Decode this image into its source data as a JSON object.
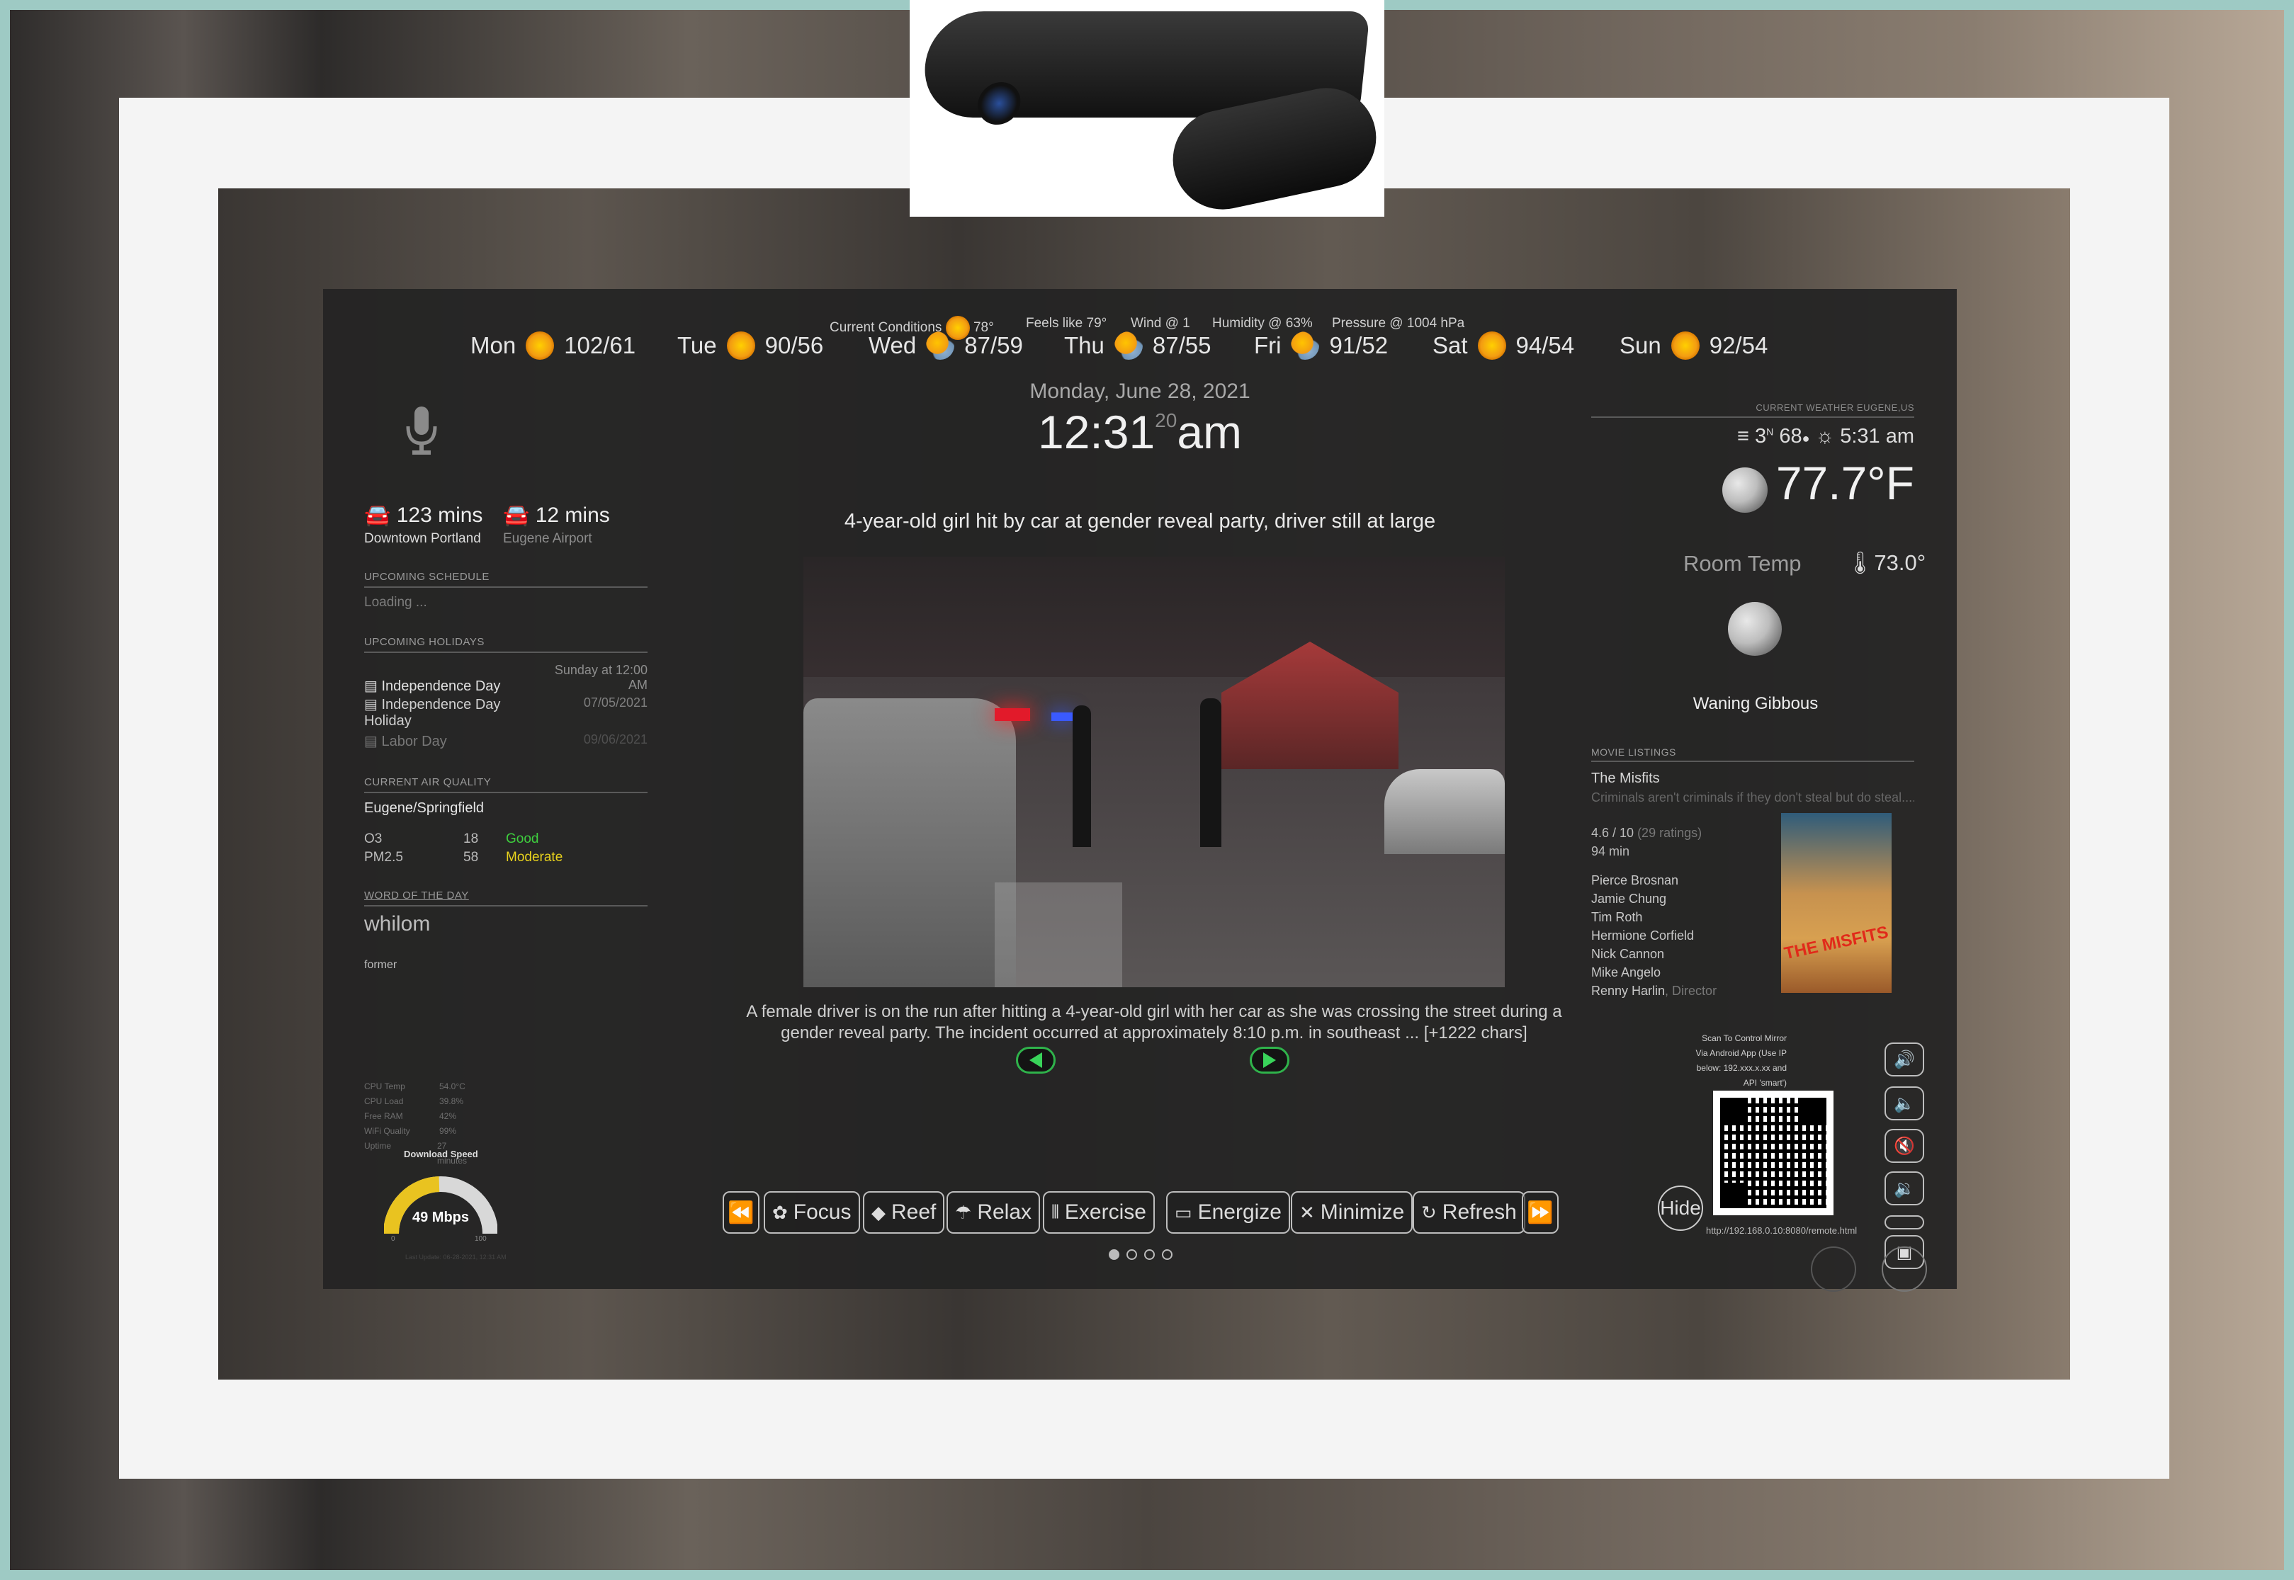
{
  "forecast": [
    {
      "day": "Mon",
      "temps": "102/61",
      "icon": "sun-icon"
    },
    {
      "day": "Tue",
      "temps": "90/56",
      "icon": "sun-icon"
    },
    {
      "day": "Wed",
      "temps": "87/59",
      "icon": "partly-sunny-icon"
    },
    {
      "day": "Thu",
      "temps": "87/55",
      "icon": "partly-sunny-icon"
    },
    {
      "day": "Fri",
      "temps": "91/52",
      "icon": "partly-sunny-icon"
    },
    {
      "day": "Sat",
      "temps": "94/54",
      "icon": "sun-icon"
    },
    {
      "day": "Sun",
      "temps": "92/54",
      "icon": "sun-icon"
    }
  ],
  "conditions": {
    "current": "Current Conditions",
    "current_temp": "78°",
    "feels": "Feels like 79°",
    "wind": "Wind @ 1",
    "humidity": "Humidity @ 63%",
    "pressure": "Pressure @ 1004 hPa"
  },
  "clock": {
    "date": "Monday, June 28, 2021",
    "time": "12:31",
    "seconds": "20",
    "ampm": "am"
  },
  "travel": [
    {
      "time": "123 mins",
      "dest": "Downtown Portland"
    },
    {
      "time": "12 mins",
      "dest": "Eugene Airport"
    }
  ],
  "schedule": {
    "header": "UPCOMING SCHEDULE",
    "status": "Loading ..."
  },
  "holidays": {
    "header": "UPCOMING HOLIDAYS",
    "items": [
      {
        "name": "Independence Day",
        "when": "Sunday at 12:00 AM"
      },
      {
        "name": "Independence Day Holiday",
        "when": "07/05/2021"
      },
      {
        "name": "Labor Day",
        "when": "09/06/2021"
      }
    ]
  },
  "air": {
    "header": "CURRENT AIR QUALITY",
    "location": "Eugene/Springfield",
    "rows": [
      {
        "pollutant": "O3",
        "value": "18",
        "label": "Good",
        "color": "#3ecf3e"
      },
      {
        "pollutant": "PM2.5",
        "value": "58",
        "label": "Moderate",
        "color": "#e8d21d"
      }
    ]
  },
  "word": {
    "header": "WORD OF THE DAY",
    "word": "whilom",
    "definition": "former"
  },
  "sysinfo": [
    {
      "label": "CPU Temp",
      "value": "54.0°C"
    },
    {
      "label": "CPU Load",
      "value": "39.8%"
    },
    {
      "label": "Free RAM",
      "value": "42%"
    },
    {
      "label": "WiFi Quality",
      "value": "99%"
    },
    {
      "label": "Uptime",
      "value": "27 minutes"
    }
  ],
  "speed": {
    "title": "Download Speed",
    "value": "49 Mbps",
    "min": "0",
    "max": "100",
    "fill": 0.49,
    "updated": "Last Update: 06-28-2021, 12:31 AM"
  },
  "news": {
    "headline": "4-year-old girl hit by car at gender reveal party, driver still at large",
    "body": "A female driver is on the run after hitting a 4-year-old girl with her car as she was crossing the street during a gender reveal party. The incident occurred at approximately 8:10 p.m. in southeast ... [+1222 chars]"
  },
  "weather": {
    "header": "CURRENT WEATHER EUGENE,US",
    "wind": "3",
    "wind_dir": "N",
    "humidity": "68",
    "sunrise": "5:31 am",
    "temp": "77.7°F",
    "room_label": "Room Temp",
    "room_temp": "73.0°",
    "moon_phase": "Waning Gibbous"
  },
  "movie": {
    "header": "MOVIE LISTINGS",
    "title": "The Misfits",
    "tagline": "Criminals aren't criminals if they don't steal but do steal....",
    "rating": "4.6 / 10",
    "ratings_count": "(29 ratings)",
    "runtime": "94 min",
    "cast": [
      "Pierce Brosnan",
      "Jamie Chung",
      "Tim Roth",
      "Hermione Corfield",
      "Nick Cannon",
      "Mike Angelo"
    ],
    "director": "Renny Harlin",
    "director_role": ", Director",
    "poster_text": "THE MISFITS"
  },
  "qr": {
    "caption": "Scan To Control Mirror Via Android App (Use IP below: 192.xxx.x.xx and API 'smart')",
    "url": "http://192.168.0.10:8080/remote.html",
    "hide": "Hide"
  },
  "buttons": [
    "Focus",
    "Reef",
    "Relax",
    "Exercise",
    "Energize",
    "Minimize",
    "Refresh"
  ],
  "pages": 4,
  "active_page": 1
}
